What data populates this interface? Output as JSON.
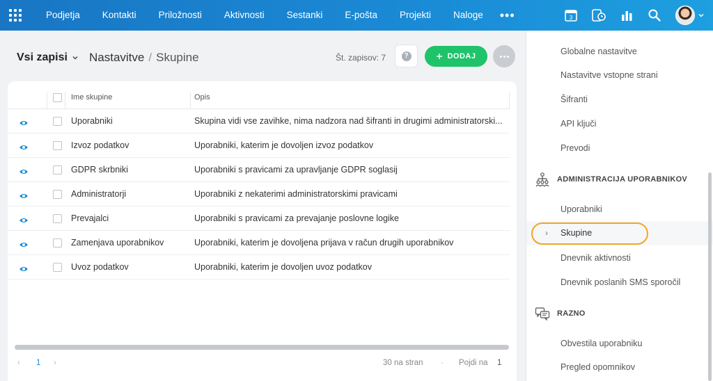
{
  "nav": {
    "items": [
      "Podjetja",
      "Kontakti",
      "Priložnosti",
      "Aktivnosti",
      "Sestanki",
      "E-pošta",
      "Projekti",
      "Naloge"
    ],
    "more": "•••",
    "calendar_day": "3"
  },
  "header": {
    "view_title": "Vsi zapisi",
    "breadcrumb_root": "Nastavitve",
    "breadcrumb_sep": "/",
    "breadcrumb_current": "Skupine",
    "record_count": "Št. zapisov: 7",
    "help_label": "?",
    "add_label": "DODAJ"
  },
  "table": {
    "col_name": "Ime skupine",
    "col_desc": "Opis",
    "rows": [
      {
        "name": "Uporabniki",
        "desc": "Skupina vidi vse zavihke, nima nadzora nad šifranti in drugimi administratorski..."
      },
      {
        "name": "Izvoz podatkov",
        "desc": "Uporabniki, katerim je dovoljen izvoz podatkov"
      },
      {
        "name": "GDPR skrbniki",
        "desc": "Uporabniki s pravicami za upravljanje GDPR soglasij"
      },
      {
        "name": "Administratorji",
        "desc": "Uporabniki z nekaterimi administratorskimi pravicami"
      },
      {
        "name": "Prevajalci",
        "desc": "Uporabniki s pravicami za prevajanje poslovne logike"
      },
      {
        "name": "Zamenjava uporabnikov",
        "desc": "Uporabniki, katerim je dovoljena prijava v račun drugih uporabnikov"
      },
      {
        "name": "Uvoz podatkov",
        "desc": "Uporabniki, katerim je dovoljen uvoz podatkov"
      }
    ]
  },
  "pager": {
    "prev": "‹",
    "page": "1",
    "next": "›",
    "per_page": "30 na stran",
    "dash": "-",
    "goto_label": "Pojdi na",
    "goto_value": "1"
  },
  "panel": {
    "items_top": [
      "Globalne nastavitve",
      "Nastavitve vstopne strani",
      "Šifranti",
      "API ključi",
      "Prevodi"
    ],
    "section_admin": "ADMINISTRACIJA UPORABNIKOV",
    "admin_items": [
      "Uporabniki",
      "Skupine",
      "Dnevnik aktivnosti",
      "Dnevnik poslanih SMS sporočil"
    ],
    "active_chevron": "›",
    "section_misc": "RAZNO",
    "misc_items": [
      "Obvestila uporabniku",
      "Pregled opomnikov"
    ]
  },
  "colors": {
    "accent": "#1a8bd6",
    "add_button": "#1ec36a",
    "highlight_ring": "#f2a623"
  }
}
